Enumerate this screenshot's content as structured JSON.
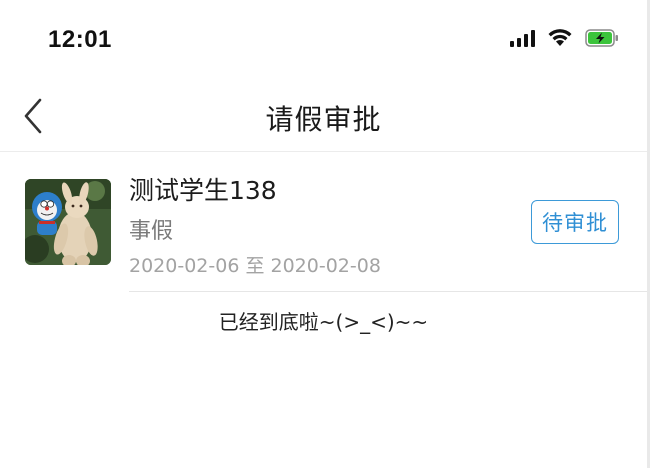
{
  "status_bar": {
    "time": "12:01",
    "icons": [
      "cellular-signal-icon",
      "wifi-icon",
      "battery-charging-icon"
    ],
    "battery_color": "#3cc43c"
  },
  "header": {
    "back_icon": "chevron-left-icon",
    "title": "请假审批"
  },
  "leave_requests": [
    {
      "avatar": "toy-photo-avatar",
      "student_name": "测试学生138",
      "leave_type": "事假",
      "date_range": "2020-02-06 至 2020-02-08",
      "status": "待审批",
      "status_color": "#2f8fd4"
    }
  ],
  "list_end_message": "已经到底啦~(>_<)~~"
}
